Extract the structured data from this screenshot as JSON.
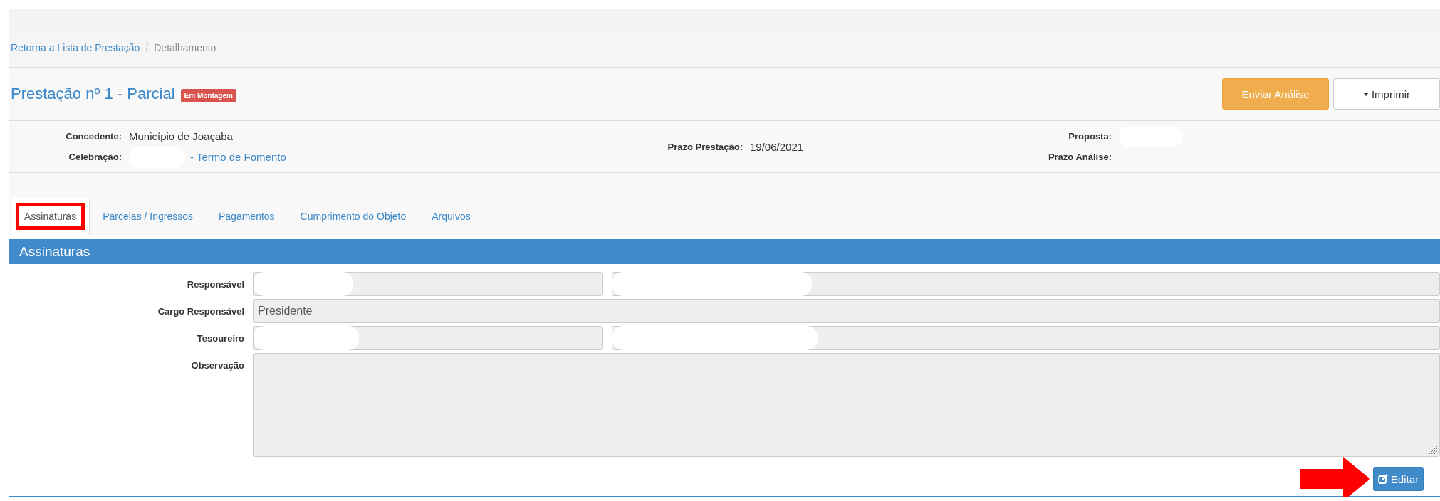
{
  "breadcrumb": [
    {
      "label": "Retorna a Lista de Prestação",
      "link": true
    },
    {
      "label": "Detalhamento",
      "link": false
    }
  ],
  "breadcrumb_separator": "/",
  "title": "Prestação nº 1 - Parcial",
  "badge": "Em Montagem",
  "actions": [
    {
      "label": "Enviar Análise",
      "kind": "primary"
    },
    {
      "label": "Imprimir",
      "kind": "dropdown"
    }
  ],
  "info": {
    "left": [
      {
        "label": "Concedente:",
        "value": "Município de Joaçaba",
        "redacted": false
      },
      {
        "label": "Celebração:",
        "value": "- Termo de Fomento",
        "redacted": true,
        "link": true
      }
    ],
    "middle": [
      {
        "label": "Prazo Prestação:",
        "value": "19/06/2021",
        "redacted": false
      }
    ],
    "right": [
      {
        "label": "Proposta:",
        "redacted": true
      },
      {
        "label": "Prazo Análise:",
        "redacted": false
      }
    ]
  },
  "tabs": [
    {
      "label": "Assinaturas",
      "selected": true,
      "highlighted": true
    },
    {
      "label": "Parcelas / Ingressos",
      "selected": false,
      "highlighted": false
    },
    {
      "label": "Pagamentos",
      "selected": false,
      "highlighted": false
    },
    {
      "label": "Cumprimento do Objeto",
      "selected": false,
      "highlighted": false
    },
    {
      "label": "Arquivos",
      "selected": false,
      "highlighted": false
    }
  ],
  "panel": {
    "title": "Assinaturas",
    "fields": [
      {
        "label": "Responsável",
        "kind": "pair",
        "redacted": [
          true,
          true
        ]
      },
      {
        "label": "Cargo Responsável",
        "kind": "text",
        "value": "Presidente"
      },
      {
        "label": "Tesoureiro",
        "kind": "pair",
        "redacted": [
          true,
          true
        ]
      },
      {
        "label": "Observação",
        "kind": "textarea"
      }
    ],
    "edit_button": "Editar",
    "edit_pointer": true
  }
}
